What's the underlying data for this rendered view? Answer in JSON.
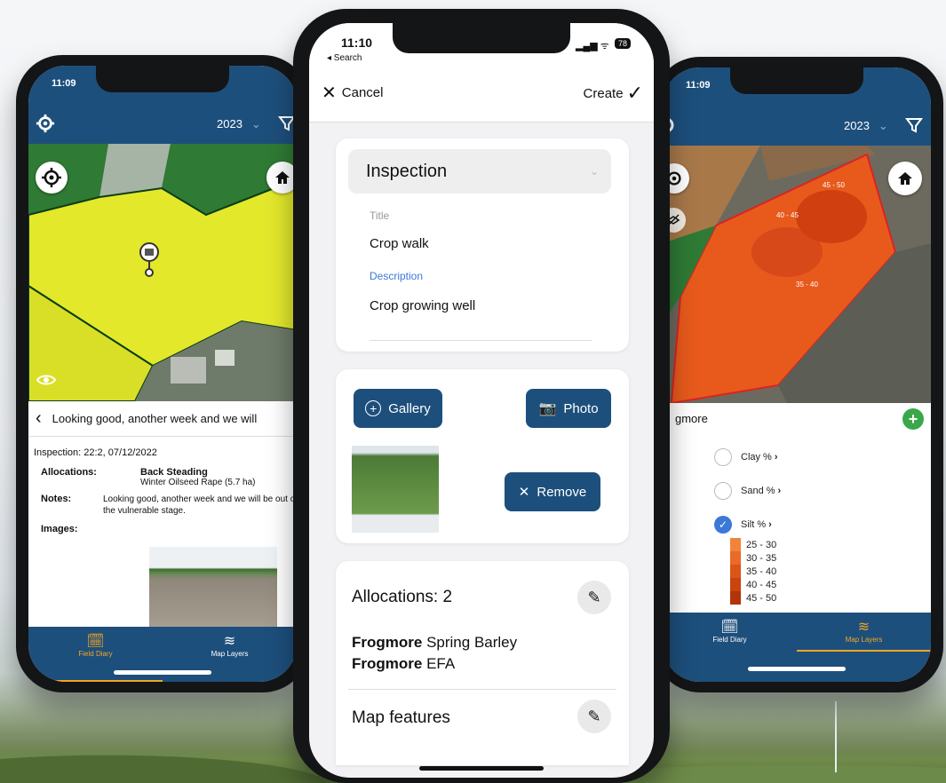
{
  "left_phone": {
    "status_time": "11:09",
    "year": "2023",
    "entry_header": "Looking good, another week and we will",
    "inspection_line": "Inspection: 22:2, 07/12/2022",
    "allocations_label": "Allocations:",
    "allocation_name": "Back Steading",
    "allocation_crop": "Winter Oilseed Rape (5.7 ha)",
    "notes_label": "Notes:",
    "notes_text": "Looking good, another week and we will be out of the vulnerable stage.",
    "images_label": "Images:",
    "tabs": [
      {
        "label": "Field Diary",
        "active": true
      },
      {
        "label": "Map Layers",
        "active": false
      }
    ]
  },
  "center_phone": {
    "status_time": "11:10",
    "back_label": "◂ Search",
    "battery": "78",
    "cancel_label": "Cancel",
    "create_label": "Create",
    "type_select": "Inspection",
    "title_label": "Title",
    "title_value": "Crop walk",
    "description_label": "Description",
    "description_value": "Crop growing well",
    "gallery_label": "Gallery",
    "photo_label": "Photo",
    "remove_label": "Remove",
    "allocations_heading": "Allocations: 2",
    "allocations": [
      {
        "field": "Frogmore",
        "crop": "Spring Barley"
      },
      {
        "field": "Frogmore",
        "crop": "EFA"
      }
    ],
    "map_features_heading": "Map features"
  },
  "right_phone": {
    "status_time": "11:09",
    "year": "2023",
    "map_labels": [
      "45 - 50",
      "40 - 45",
      "35 - 40"
    ],
    "field_name": "gmore",
    "layers": [
      {
        "label": "Clay %",
        "checked": false
      },
      {
        "label": "Sand %",
        "checked": false
      },
      {
        "label": "Silt %",
        "checked": true
      }
    ],
    "legend": [
      {
        "label": "25 - 30",
        "color": "#f2833a"
      },
      {
        "label": "30 - 35",
        "color": "#ea6a26"
      },
      {
        "label": "35 - 40",
        "color": "#dd5418"
      },
      {
        "label": "40 - 45",
        "color": "#c9440f"
      },
      {
        "label": "45 - 50",
        "color": "#b23408"
      }
    ],
    "tabs": [
      {
        "label": "Field Diary",
        "active": false
      },
      {
        "label": "Map Layers",
        "active": true
      }
    ]
  },
  "colors": {
    "navy": "#1d4f7c",
    "accent_orange": "#f5a623",
    "add_green": "#3aa84a",
    "check_blue": "#3c78d8"
  }
}
